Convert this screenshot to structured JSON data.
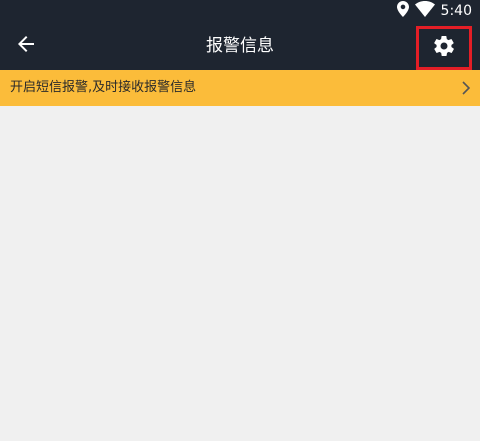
{
  "status_bar": {
    "time": "5:40",
    "icons": [
      "location-icon",
      "wifi-icon"
    ]
  },
  "toolbar": {
    "title": "报警信息",
    "back_icon": "arrow-left-icon",
    "settings_icon": "gear-icon",
    "highlight_color": "#e41e26"
  },
  "banner": {
    "text": "开启短信报警,及时接收报警信息",
    "chevron_icon": "chevron-right-icon",
    "background": "#fbbc3a"
  },
  "colors": {
    "toolbar_bg": "#1e2530",
    "page_bg": "#f0f0f0"
  }
}
